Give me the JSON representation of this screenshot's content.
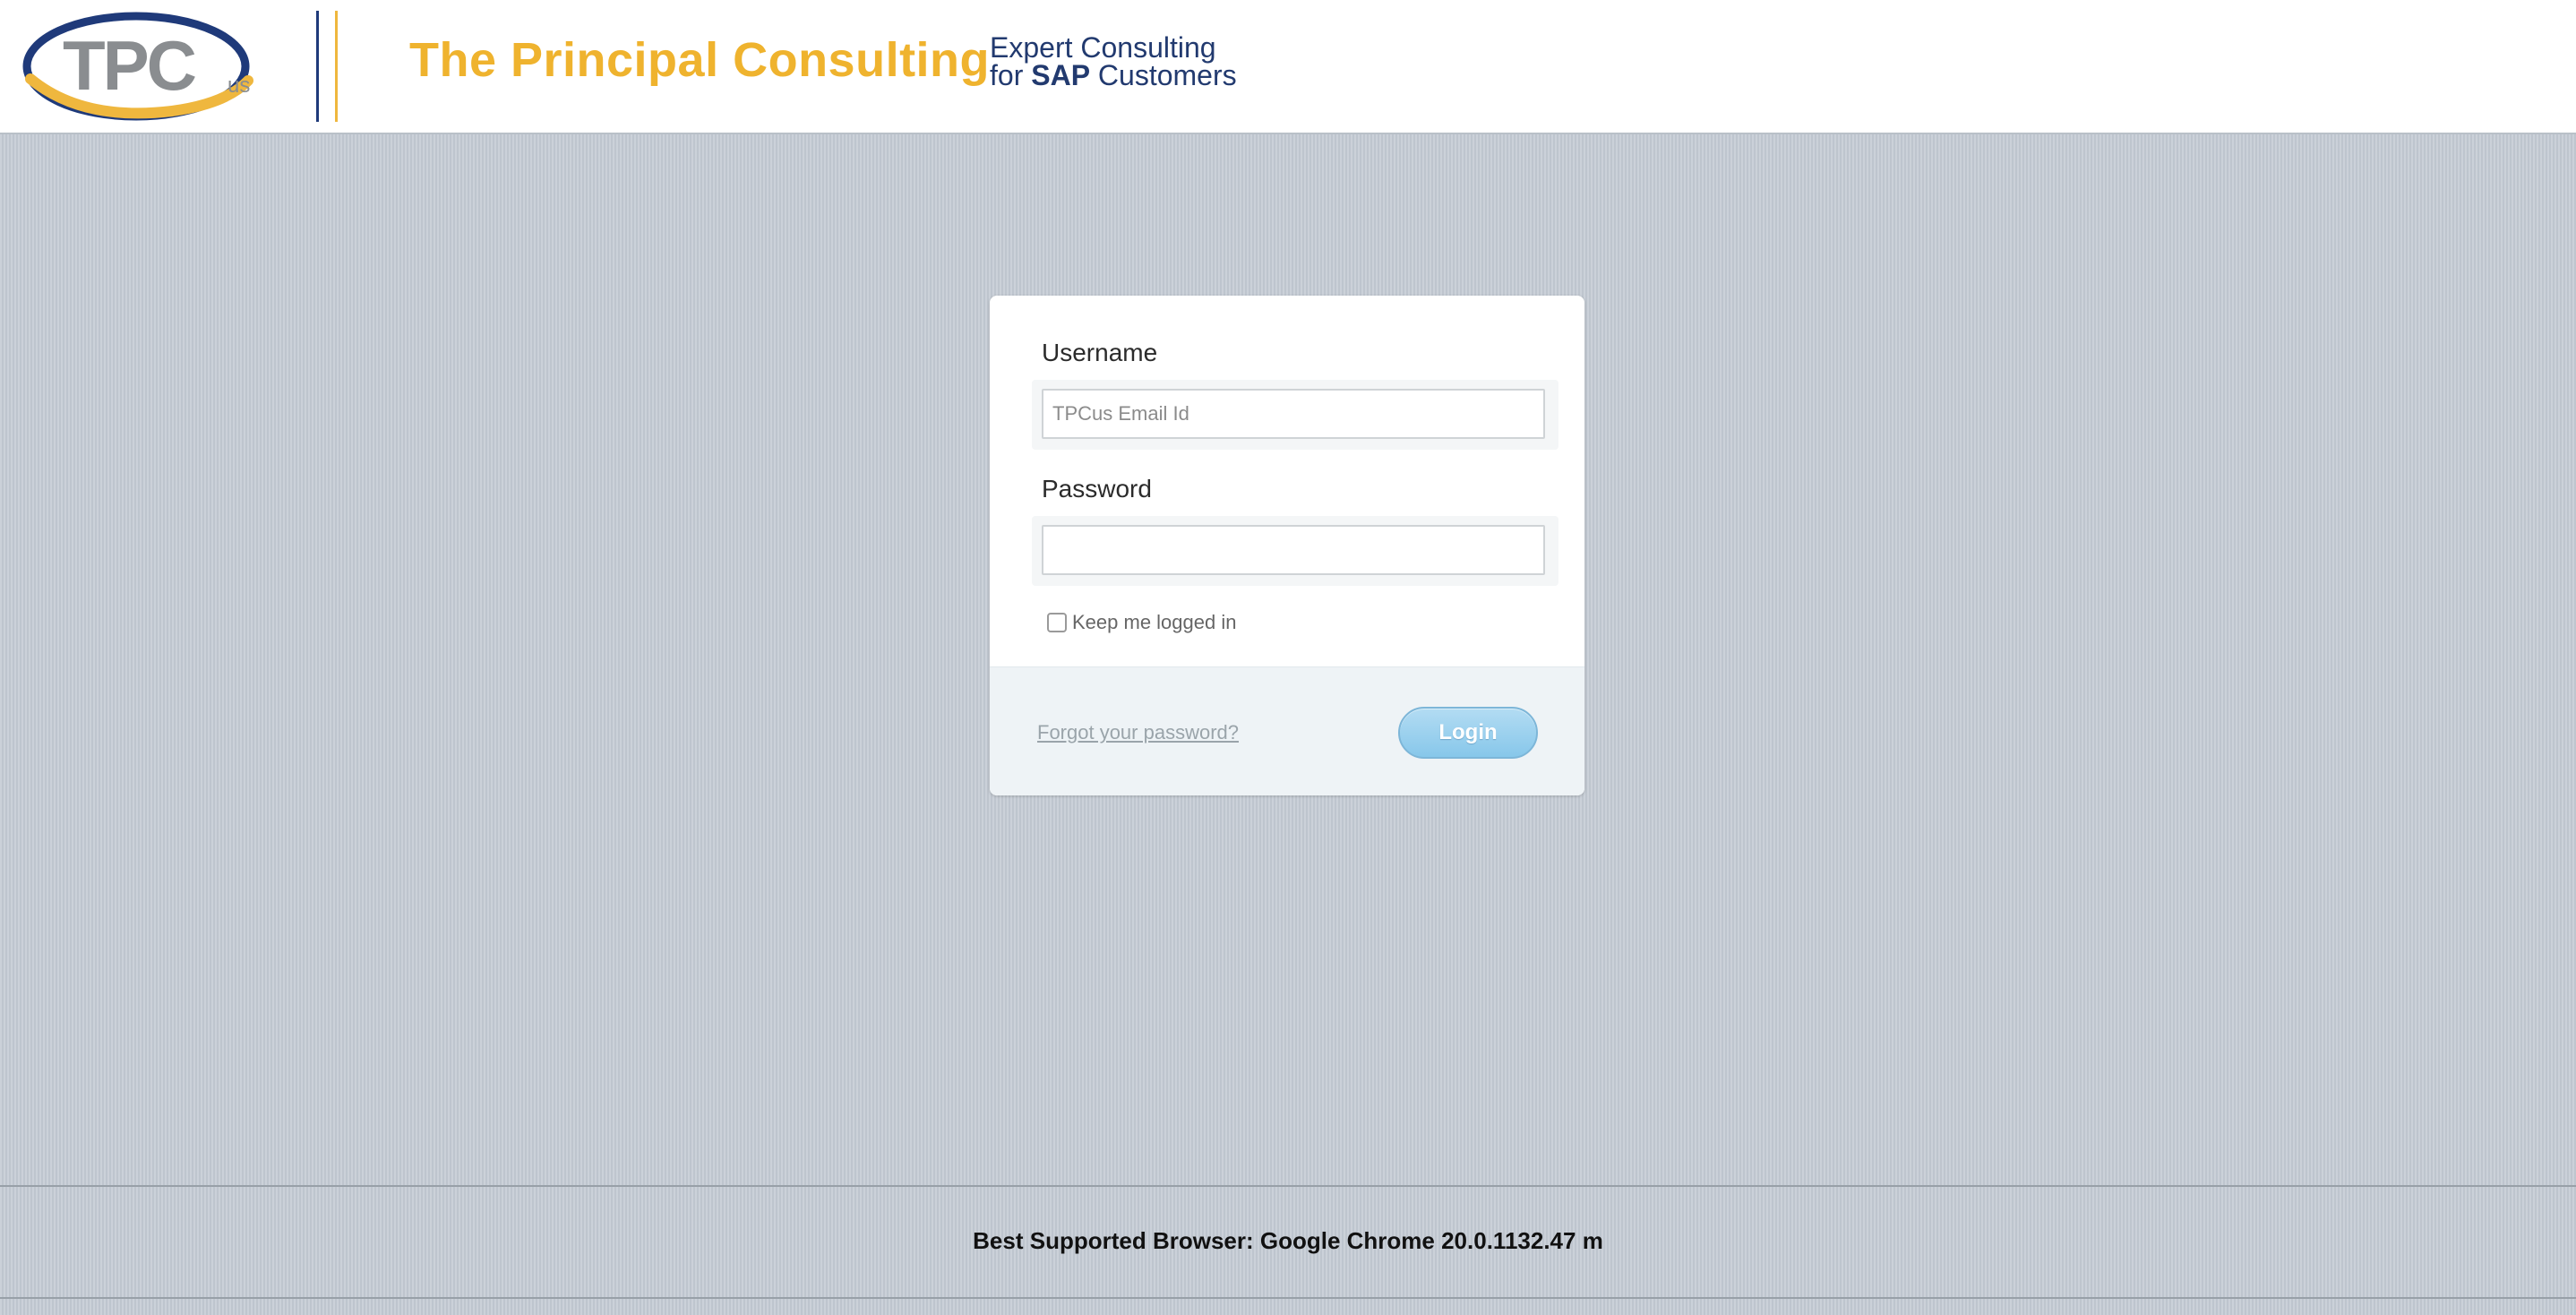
{
  "header": {
    "logo_text": "TPC",
    "logo_suffix": "us",
    "company_name": "The Principal Consulting",
    "tagline_line1": "Expert Consulting",
    "tagline_line2_prefix": "for ",
    "tagline_line2_bold": "SAP",
    "tagline_line2_suffix": " Customers"
  },
  "login": {
    "username_label": "Username",
    "username_placeholder": "TPCus Email Id",
    "username_value": "",
    "password_label": "Password",
    "password_value": "",
    "remember_label": "Keep me logged in",
    "remember_checked": false,
    "forgot_link": "Forgot your password?",
    "login_button": "Login"
  },
  "footer": {
    "supported_browser": "Best Supported Browser: Google Chrome 20.0.1132.47 m"
  },
  "colors": {
    "brand_yellow": "#efb32e",
    "brand_blue": "#223a6f",
    "logo_gray": "#8a8d90",
    "button_blue": "#87c7ea",
    "page_background": "#c5ccd5"
  },
  "icons": {
    "logo": "tpc-swoosh-logo"
  }
}
